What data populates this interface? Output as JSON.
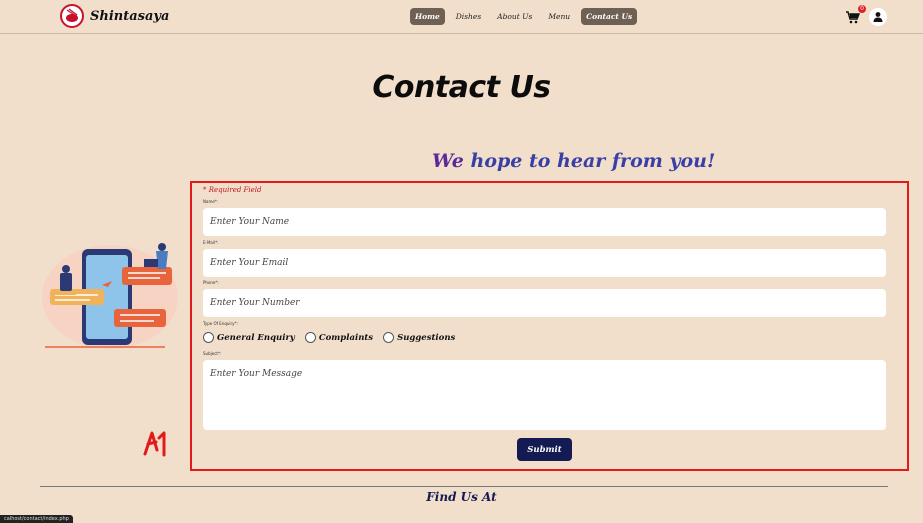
{
  "brand": {
    "name": "Shintasaya"
  },
  "nav": {
    "items": [
      {
        "label": "Home",
        "pill": true
      },
      {
        "label": "Dishes",
        "pill": false
      },
      {
        "label": "About Us",
        "pill": false
      },
      {
        "label": "Menu",
        "pill": false
      },
      {
        "label": "Contact Us",
        "pill": true
      }
    ],
    "cart_count": "0"
  },
  "page": {
    "title": "Contact Us",
    "tagline_prefix": "We",
    "tagline_rest": " hope to hear from you!"
  },
  "form": {
    "required_note": "* Required Field",
    "name_label": "Name*:",
    "name_placeholder": "Enter Your Name",
    "email_label": "E-Mail*:",
    "email_placeholder": "Enter Your Email",
    "phone_label": "Phone*:",
    "phone_placeholder": "Enter Your Number",
    "enquiry_label": "Type Of Enquiry*:",
    "enquiry_options": [
      "General Enquiry",
      "Complaints",
      "Suggestions"
    ],
    "subject_label": "Subject*:",
    "message_placeholder": "Enter Your Message",
    "submit_label": "Submit"
  },
  "footer": {
    "find_us": "Find Us At"
  },
  "status_bar": {
    "url": "calhost/contact/index.php"
  },
  "colors": {
    "background": "#f1dfcc",
    "nav_pill": "#6e6052",
    "submit": "#141a52",
    "tagline": "#3a3fa5",
    "annotation_red": "#e11a1a",
    "required_red": "#c0181f"
  },
  "icons": [
    "logo-emblem-icon",
    "cart-icon",
    "user-icon",
    "contact-illustration"
  ],
  "annotation": {
    "mark": "A1"
  }
}
